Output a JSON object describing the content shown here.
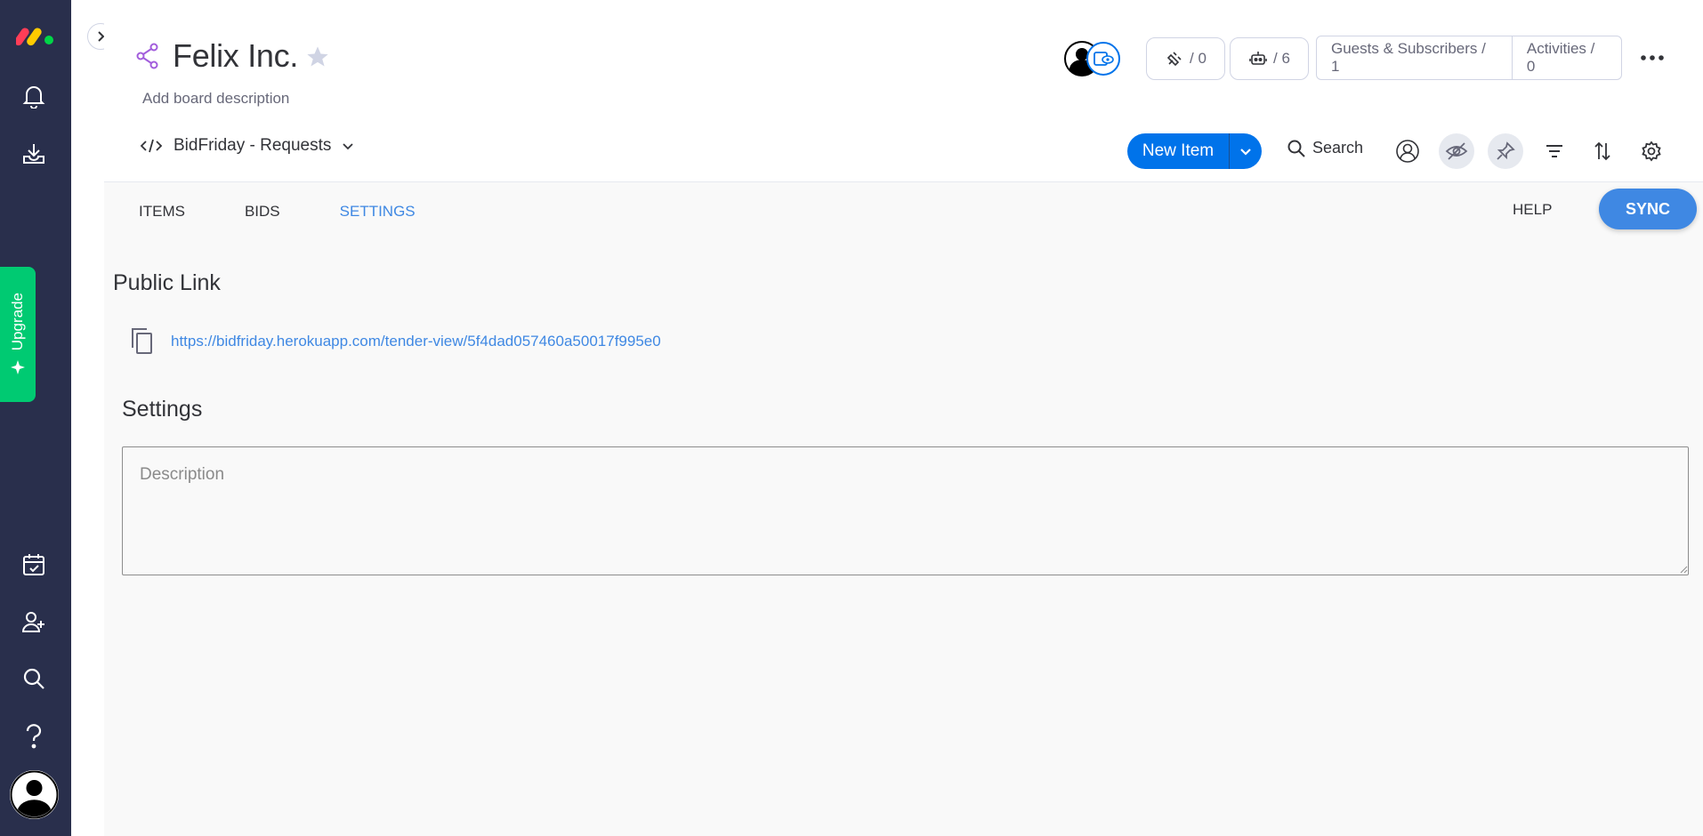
{
  "colors": {
    "rail_bg": "#292f4c",
    "upgrade_green": "#00ca72",
    "primary_blue": "#0073ea",
    "link_blue": "#3f88e3",
    "content_bg": "#f9f9f9"
  },
  "rail": {
    "logo": "monday-logo",
    "top_icons": [
      "bell-icon",
      "download-icon"
    ],
    "upgrade_label": "Upgrade",
    "bottom_icons": [
      "calendar-check-icon",
      "add-user-icon",
      "search-icon",
      "help-icon"
    ],
    "avatar": "user-avatar-icon"
  },
  "header": {
    "title": "Felix Inc.",
    "description": "Add board description",
    "integrations_count": "/ 0",
    "automations_count": "/ 6",
    "guests_label": "Guests & Subscribers / 1",
    "activities_label": "Activities / 0",
    "view_name": "BidFriday - Requests",
    "new_item_label": "New Item",
    "search_label": "Search"
  },
  "tabs": [
    {
      "label": "ITEMS",
      "active": false
    },
    {
      "label": "BIDS",
      "active": false
    },
    {
      "label": "SETTINGS",
      "active": true
    }
  ],
  "help_label": "HELP",
  "sync_label": "SYNC",
  "public_link": {
    "title": "Public Link",
    "url": "https://bidfriday.herokuapp.com/tender-view/5f4dad057460a50017f995e0"
  },
  "settings": {
    "title": "Settings",
    "description_placeholder": "Description",
    "description_value": ""
  }
}
